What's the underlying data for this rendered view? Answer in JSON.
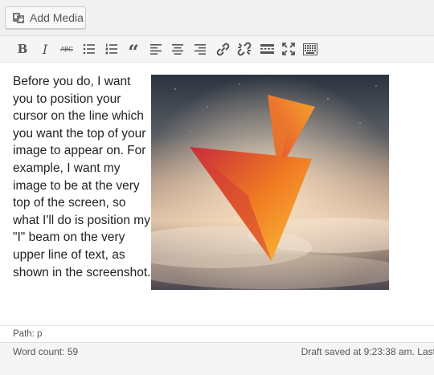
{
  "media_button": {
    "label": "Add Media",
    "icon": "media-icon"
  },
  "toolbar": {
    "buttons": [
      {
        "name": "bold",
        "glyph": "B"
      },
      {
        "name": "italic",
        "glyph": "I"
      },
      {
        "name": "strikethrough",
        "glyph": "ABC"
      },
      {
        "name": "bulleted-list",
        "glyph": ""
      },
      {
        "name": "numbered-list",
        "glyph": ""
      },
      {
        "name": "blockquote",
        "glyph": "“"
      },
      {
        "name": "align-left",
        "glyph": ""
      },
      {
        "name": "align-center",
        "glyph": ""
      },
      {
        "name": "align-right",
        "glyph": ""
      },
      {
        "name": "insert-link",
        "glyph": ""
      },
      {
        "name": "remove-link",
        "glyph": ""
      },
      {
        "name": "read-more",
        "glyph": ""
      },
      {
        "name": "fullscreen",
        "glyph": ""
      },
      {
        "name": "toolbar-toggle",
        "glyph": ""
      }
    ]
  },
  "content": {
    "paragraph": "Before you do, I want you to position your cursor on the line which you want the top of your image to appear on. For example, I want my image to be at the very top of the screen, so what I'll do is position my \"I\" beam on the very upper line of text, as shown in the screenshot.",
    "image_alt": "inserted-image"
  },
  "path_bar": {
    "text": "Path: p"
  },
  "status_bar": {
    "word_count_label": "Word count: 59",
    "draft_text": "Draft saved at 9:23:38 am. Last"
  },
  "colors": {
    "toolbar_bg": "#f5f5f5",
    "icon": "#555555",
    "text": "#222222"
  }
}
